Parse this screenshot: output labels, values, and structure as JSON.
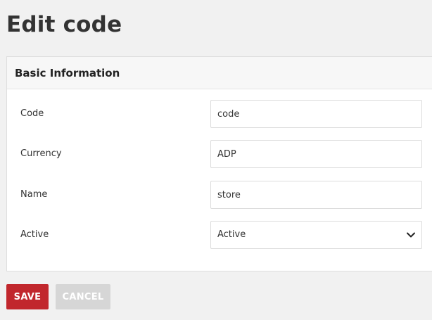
{
  "page": {
    "title": "Edit code"
  },
  "panel": {
    "title": "Basic Information"
  },
  "form": {
    "code": {
      "label": "Code",
      "value": "code"
    },
    "currency": {
      "label": "Currency",
      "value": "ADP"
    },
    "name": {
      "label": "Name",
      "value": "store"
    },
    "active": {
      "label": "Active",
      "value": "Active",
      "icon": "chevron-down-icon"
    }
  },
  "actions": {
    "save_label": "SAVE",
    "cancel_label": "CANCEL"
  },
  "colors": {
    "primary": "#c1272d",
    "disabled": "#d6d6d6",
    "background": "#f1f1f1"
  }
}
